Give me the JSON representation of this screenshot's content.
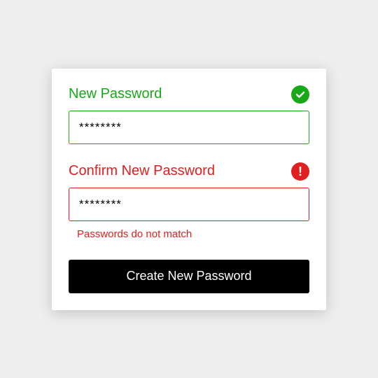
{
  "newPassword": {
    "label": "New Password",
    "value": "********",
    "status": "valid"
  },
  "confirmPassword": {
    "label": "Confirm New Password",
    "value": "********",
    "status": "error",
    "errorMessage": "Passwords do not match"
  },
  "submit": {
    "label": "Create New Password"
  },
  "colors": {
    "valid": "#18a818",
    "error": "#e02020"
  }
}
